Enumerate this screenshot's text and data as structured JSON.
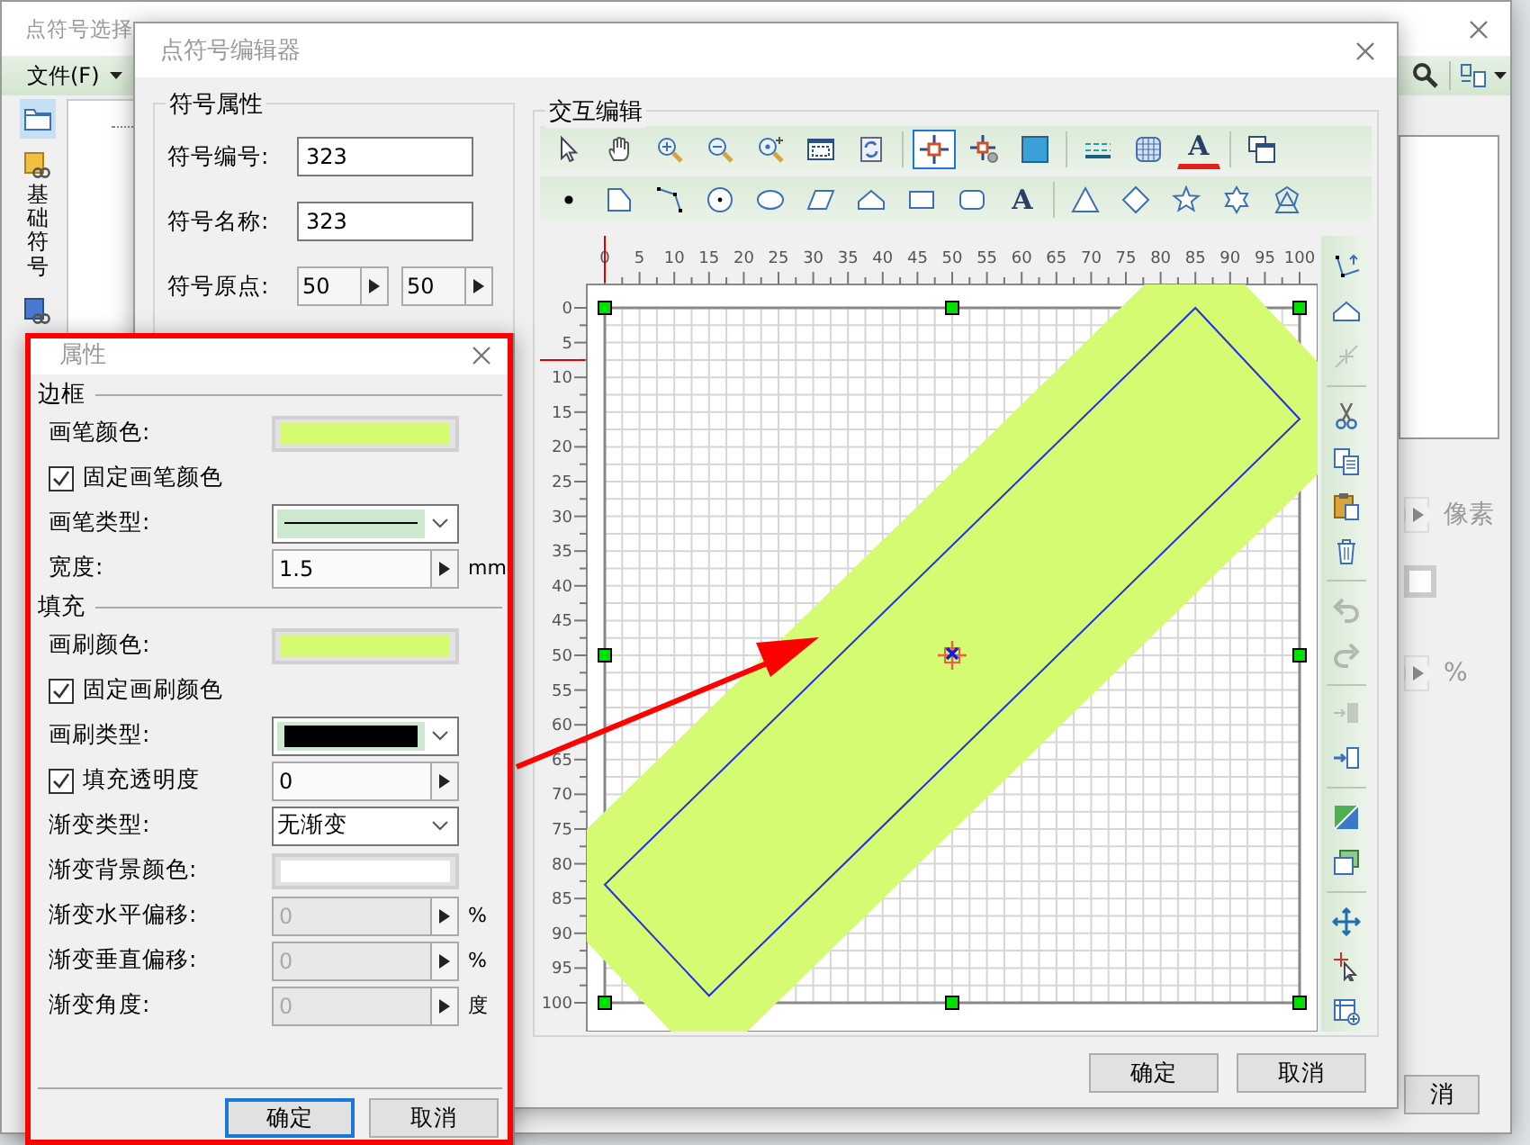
{
  "selector_window": {
    "title": "点符号选择",
    "menu": [
      {
        "label": "文件(F)"
      }
    ],
    "sidebar_tabs": [
      {
        "kind": "folder",
        "selected": true
      },
      {
        "kind": "library",
        "label": "基础符号",
        "selected": false
      },
      {
        "kind": "library_alt",
        "selected": false
      }
    ],
    "right_panel": {
      "size_unit": "像素",
      "percent_unit": "%",
      "cancel_button": "消"
    }
  },
  "editor_window": {
    "title": "点符号编辑器",
    "symbol_properties": {
      "title": "符号属性",
      "fields": [
        {
          "kind": "text",
          "label": "符号编号:",
          "value": "323"
        },
        {
          "kind": "text",
          "label": "符号名称:",
          "value": "323"
        },
        {
          "kind": "spin_pair",
          "label": "符号原点:",
          "values": [
            "50",
            "50"
          ]
        }
      ]
    },
    "interactive_edit": {
      "title": "交互编辑",
      "toolbar_rows": [
        {
          "groups": [
            [
              {
                "kind": "pointer",
                "selected": false
              },
              {
                "kind": "hand",
                "selected": false
              },
              {
                "kind": "zoom_in",
                "selected": false
              },
              {
                "kind": "zoom_out",
                "selected": false
              },
              {
                "kind": "zoom_query",
                "selected": false
              },
              {
                "kind": "full_extent",
                "selected": false
              },
              {
                "kind": "refresh",
                "selected": false
              }
            ],
            [
              {
                "kind": "crosshair",
                "selected": true
              },
              {
                "kind": "crosshair_gear",
                "selected": false
              },
              {
                "kind": "filled_square",
                "selected": false
              }
            ],
            [
              {
                "kind": "dashed_lines",
                "selected": false
              },
              {
                "kind": "grid",
                "selected": false
              },
              {
                "kind": "text_color",
                "glyph": "A",
                "selected": false
              }
            ],
            [
              {
                "kind": "windows",
                "selected": false
              }
            ]
          ]
        },
        {
          "groups": [
            [
              {
                "kind": "dot",
                "selected": false
              },
              {
                "kind": "corner_shape",
                "selected": false
              },
              {
                "kind": "node_line",
                "selected": false
              },
              {
                "kind": "circle_dot",
                "selected": false
              },
              {
                "kind": "ellipse",
                "selected": false
              },
              {
                "kind": "parallelogram",
                "selected": false
              },
              {
                "kind": "house",
                "selected": false
              },
              {
                "kind": "rectangle",
                "selected": false
              },
              {
                "kind": "rounded_rectangle",
                "selected": false
              },
              {
                "kind": "text",
                "glyph": "A",
                "selected": false
              }
            ],
            [
              {
                "kind": "triangle",
                "selected": false
              },
              {
                "kind": "diamond",
                "selected": false
              },
              {
                "kind": "star",
                "selected": false
              },
              {
                "kind": "six_point_star",
                "selected": false
              },
              {
                "kind": "polygon_combo",
                "selected": false
              }
            ]
          ]
        }
      ],
      "side_toolbar": [
        [
          {
            "kind": "node_edit",
            "disabled": false
          },
          {
            "kind": "house",
            "disabled": false
          },
          {
            "kind": "split_arrows",
            "disabled": true
          }
        ],
        [
          {
            "kind": "scissors",
            "disabled": false
          },
          {
            "kind": "copy",
            "disabled": false
          },
          {
            "kind": "paste",
            "disabled": false
          },
          {
            "kind": "trash",
            "disabled": false
          }
        ],
        [
          {
            "kind": "undo",
            "disabled": true
          },
          {
            "kind": "redo",
            "disabled": true
          }
        ],
        [
          {
            "kind": "arrow_into_box",
            "disabled": true
          },
          {
            "kind": "arrow_into_frame",
            "disabled": false
          }
        ],
        [
          {
            "kind": "diagonal_square",
            "disabled": false
          },
          {
            "kind": "layers",
            "disabled": false
          }
        ],
        [
          {
            "kind": "move",
            "disabled": false
          },
          {
            "kind": "pointer_cross",
            "disabled": false
          },
          {
            "kind": "frame_select",
            "disabled": false
          }
        ]
      ],
      "ruler_x_labels": [
        "0",
        "5",
        "10",
        "15",
        "20",
        "25",
        "30",
        "35",
        "40",
        "45",
        "50",
        "55",
        "60",
        "65",
        "70",
        "75",
        "80",
        "85",
        "90",
        "95",
        "100"
      ],
      "ruler_y_labels": [
        "0",
        "5",
        "10",
        "15",
        "20",
        "25",
        "30",
        "35",
        "40",
        "45",
        "50",
        "55",
        "60",
        "65",
        "70",
        "75",
        "80",
        "85",
        "90",
        "95",
        "100"
      ]
    },
    "buttons": [
      {
        "label": "确定"
      },
      {
        "label": "取消"
      }
    ]
  },
  "properties_panel": {
    "title": "属性",
    "sections": [
      {
        "title": "边框",
        "rows": [
          {
            "kind": "color",
            "label": "画笔颜色:",
            "color": "#d4fb72"
          },
          {
            "kind": "checkbox",
            "label": "固定画笔颜色",
            "checked": true
          },
          {
            "kind": "line_style",
            "label": "画笔类型:"
          },
          {
            "kind": "spin",
            "label": "宽度:",
            "value": "1.5",
            "unit": "mm",
            "disabled": false
          }
        ]
      },
      {
        "title": "填充",
        "rows": [
          {
            "kind": "color",
            "label": "画刷颜色:",
            "color": "#d4fb72"
          },
          {
            "kind": "checkbox",
            "label": "固定画刷颜色",
            "checked": true
          },
          {
            "kind": "brush_style",
            "label": "画刷类型:",
            "color": "#000000"
          },
          {
            "kind": "checkbox_spin",
            "label": "填充透明度",
            "checked": true,
            "value": "0"
          },
          {
            "kind": "dropdown",
            "label": "渐变类型:",
            "value": "无渐变"
          },
          {
            "kind": "color",
            "label": "渐变背景颜色:",
            "color": "#ffffff"
          },
          {
            "kind": "spin",
            "label": "渐变水平偏移:",
            "value": "0",
            "unit": "%",
            "disabled": true
          },
          {
            "kind": "spin",
            "label": "渐变垂直偏移:",
            "value": "0",
            "unit": "%",
            "disabled": true
          },
          {
            "kind": "spin",
            "label": "渐变角度:",
            "value": "0",
            "unit": "度",
            "disabled": true
          }
        ]
      }
    ],
    "buttons": [
      {
        "label": "确定",
        "default": true
      },
      {
        "label": "取消",
        "default": false
      }
    ]
  }
}
